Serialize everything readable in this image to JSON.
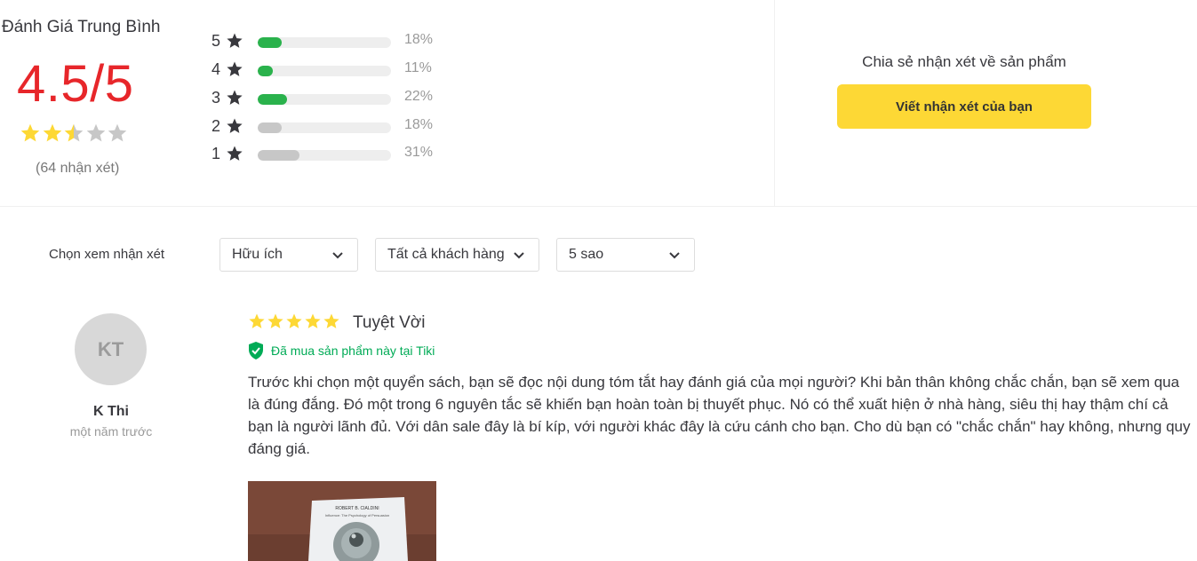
{
  "summary": {
    "title": "Đánh Giá Trung Bình",
    "average": "4.5/5",
    "average_stars": 2.5,
    "count_text": "(64 nhận xét)",
    "distribution": [
      {
        "stars": "5",
        "percent_text": "18%",
        "fraction": 0.18,
        "color": "#2ab24c"
      },
      {
        "stars": "4",
        "percent_text": "11%",
        "fraction": 0.11,
        "color": "#2ab24c"
      },
      {
        "stars": "3",
        "percent_text": "22%",
        "fraction": 0.22,
        "color": "#2ab24c"
      },
      {
        "stars": "2",
        "percent_text": "18%",
        "fraction": 0.18,
        "color": "#c7c7c7"
      },
      {
        "stars": "1",
        "percent_text": "31%",
        "fraction": 0.31,
        "color": "#c7c7c7"
      }
    ]
  },
  "share": {
    "text": "Chia sẻ nhận xét về sản phẩm",
    "button_label": "Viết nhận xét của bạn",
    "button_color": "#fdd835"
  },
  "filters": {
    "label": "Chọn xem nhận xét",
    "selects": [
      {
        "value": "Hữu ích"
      },
      {
        "value": "Tất cả khách hàng"
      },
      {
        "value": "5 sao"
      }
    ]
  },
  "review": {
    "avatar_initials": "KT",
    "reviewer_name": "K Thi",
    "time": "một năm trước",
    "rating": 5,
    "title": "Tuyệt Vời",
    "verified_text": "Đã mua sản phẩm này tại Tiki",
    "body_lines": [
      "Trước khi chọn một quyển sách, bạn sẽ đọc nội dung tóm tắt hay đánh giá của mọi người? Khi bản thân không chắc chắn, bạn sẽ xem qua",
      "là đúng đắng. Đó một trong 6 nguyên tắc sẽ khiến bạn hoàn toàn bị thuyết phục. Nó có thể xuất hiện ở nhà hàng, siêu thị hay thậm chí cả",
      "bạn là người lãnh đủ. Với dân sale đây là bí kíp, với người khác đây là cứu cánh cho bạn. Cho dù bạn có \"chắc chắn\" hay không, nhưng quy",
      "đáng giá."
    ],
    "image": {
      "author_text": "ROBERT B. CIALDINI",
      "subtitle_text": "Influence: The Psychology of Persuasion"
    }
  },
  "colors": {
    "star_gold": "#fdd835",
    "star_gray": "#c7c7c7",
    "score_red": "#e7262a",
    "verified_green": "#00ab56"
  }
}
